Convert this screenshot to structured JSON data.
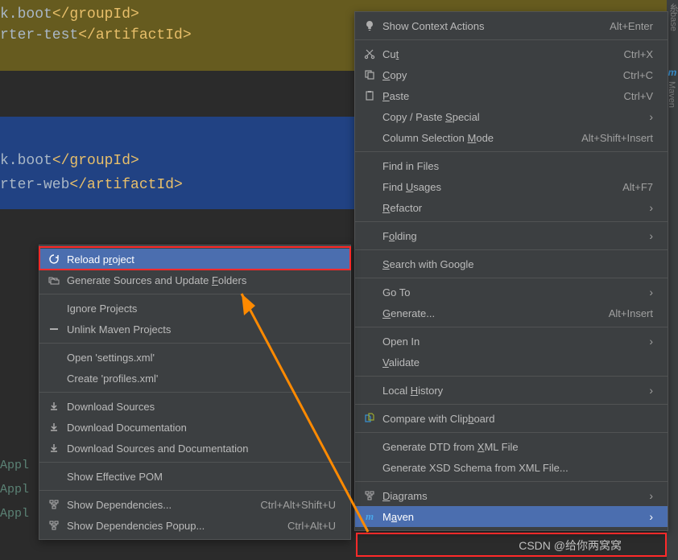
{
  "colors": {
    "menu_bg": "#3c3f41",
    "hover": "#4b6eaf",
    "red": "#ff2a2a",
    "arrow": "#ff8a00"
  },
  "code": {
    "line1_pre": "k.boot",
    "line1_tag": "</groupId>",
    "line2_pre": "rter-test",
    "line2_tag": "</artifactId>",
    "line3_pre": "k.boot",
    "line3_tag": "</groupId>",
    "line4_pre": "rter-web",
    "line4_tag": "</artifactId>",
    "gutter_a": "Appl",
    "gutter_b": "Appl",
    "gutter_c": "Appl"
  },
  "side_tool": {
    "label1": "糸base",
    "label2": "Maven",
    "letter": "m"
  },
  "main_menu": {
    "show_context_actions": "Show Context Actions",
    "show_context_actions_key": "Alt+Enter",
    "cut": "Cut",
    "cut_key": "Ctrl+X",
    "copy": "Copy",
    "copy_key": "Ctrl+C",
    "paste": "Paste",
    "paste_key": "Ctrl+V",
    "copy_paste_special": "Copy / Paste Special",
    "column_selection": "Column Selection Mode",
    "column_selection_key": "Alt+Shift+Insert",
    "find_in_files": "Find in Files",
    "find_usages": "Find Usages",
    "find_usages_key": "Alt+F7",
    "refactor": "Refactor",
    "folding": "Folding",
    "search_google": "Search with Google",
    "go_to": "Go To",
    "generate": "Generate...",
    "generate_key": "Alt+Insert",
    "open_in": "Open In",
    "validate": "Validate",
    "local_history": "Local History",
    "compare_clip": "Compare with Clipboard",
    "gen_dtd": "Generate DTD from XML File",
    "gen_xsd": "Generate XSD Schema from XML File...",
    "diagrams": "Diagrams",
    "maven": "Maven"
  },
  "sub_menu": {
    "reload": "Reload project",
    "gen_sources": "Generate Sources and Update Folders",
    "ignore_projects": "Ignore Projects",
    "unlink": "Unlink Maven Projects",
    "open_settings": "Open 'settings.xml'",
    "create_profiles": "Create 'profiles.xml'",
    "dl_sources": "Download Sources",
    "dl_docs": "Download Documentation",
    "dl_both": "Download Sources and Documentation",
    "show_effective": "Show Effective POM",
    "show_deps": "Show Dependencies...",
    "show_deps_key": "Ctrl+Alt+Shift+U",
    "show_deps_popup": "Show Dependencies Popup...",
    "show_deps_popup_key": "Ctrl+Alt+U"
  },
  "watermark": "CSDN @给你两窝窝"
}
